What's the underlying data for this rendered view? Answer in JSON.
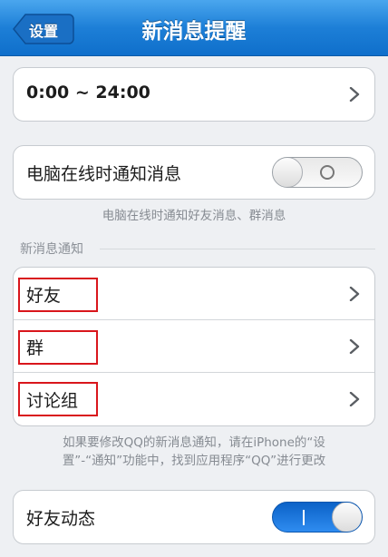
{
  "navbar": {
    "title": "新消息提醒",
    "back_label": "设置",
    "color": "#1d7fd7"
  },
  "time_range": {
    "label": "0:00 ~ 24:00"
  },
  "pc_online": {
    "label": "电脑在线时通知消息",
    "enabled": false,
    "note": "电脑在线时通知好友消息、群消息"
  },
  "new_message_section": {
    "title": "新消息通知",
    "items": [
      {
        "label": "好友",
        "icon": "chevron-right-icon"
      },
      {
        "label": "群",
        "icon": "chevron-right-icon"
      },
      {
        "label": "讨论组",
        "icon": "chevron-right-icon"
      }
    ],
    "note_line1": "如果要修改QQ的新消息通知，请在iPhone的“设",
    "note_line2": "置”-“通知”功能中，找到应用程序“QQ”进行更改"
  },
  "friend_feed": {
    "label": "好友动态",
    "enabled": true
  },
  "highlight_color": "#d9161c"
}
